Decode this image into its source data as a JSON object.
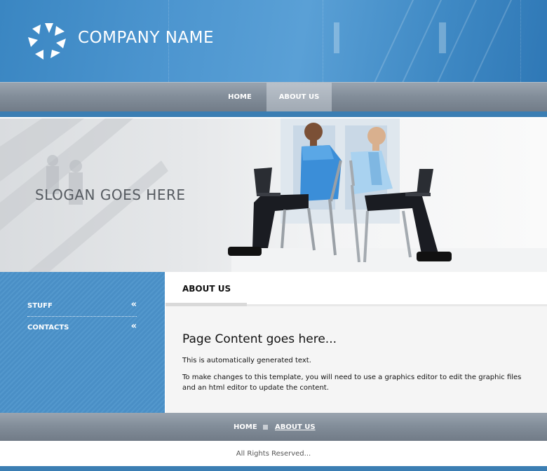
{
  "header": {
    "company_name": "COMPANY NAME",
    "logo_icon": "pinwheel-logo-icon"
  },
  "nav": {
    "items": [
      {
        "label": "HOME",
        "active": false
      },
      {
        "label": "ABOUT US",
        "active": true
      }
    ]
  },
  "banner": {
    "slogan": "SLOGAN GOES HERE"
  },
  "sidebar": {
    "items": [
      {
        "label": "STUFF",
        "icon": "double-chevron-left-icon",
        "glyph": "«"
      },
      {
        "label": "CONTACTS",
        "icon": "double-chevron-left-icon",
        "glyph": "«"
      }
    ]
  },
  "content": {
    "tab_title": "ABOUT US",
    "heading": "Page Content goes here...",
    "paragraph1": "This is automatically generated text.",
    "paragraph2": "To make changes to this template, you will need to use a graphics editor to edit the graphic files and an html editor to update the content."
  },
  "footer": {
    "links": [
      {
        "label": "HOME"
      },
      {
        "label": "ABOUT US"
      }
    ],
    "copyright": "All Rights Reserved..."
  },
  "colors": {
    "header_blue": "#4c95cf",
    "strip_blue": "#3b7eb3",
    "nav_gray": "#838e9a",
    "sidebar_blue": "#4a8fc6"
  }
}
